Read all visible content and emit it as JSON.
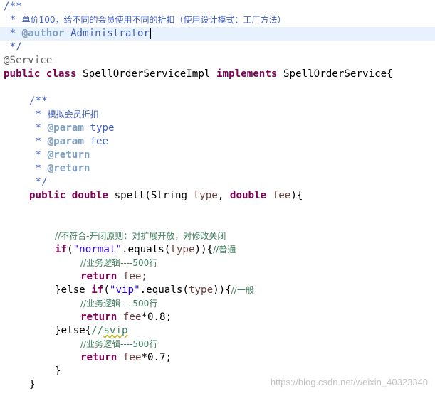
{
  "editor": {
    "javadoc_open": "/**",
    "javadoc_line_1_prefix": " * ",
    "class_doc_text": "单价100，给不同的会员使用不同的折扣（使用设计模式：工厂方法）",
    "author_tag": "@author",
    "author_name": "Administrator",
    "javadoc_close": " */",
    "annotation": "@Service",
    "kw_public": "public",
    "kw_class": "class",
    "class_name": "SpellOrderServiceImpl",
    "kw_implements": "implements",
    "interface_name": "SpellOrderService{",
    "method_doc_open": "/**",
    "method_doc_text": "模拟会员折扣",
    "param_tag": "@param",
    "param_1": "type",
    "param_2": "fee",
    "return_tag": "@return",
    "method_doc_close": "*/",
    "kw_double": "double",
    "method_name": "spell(String",
    "param_type": "type",
    "param_fee": "fee",
    "method_open_tail": "){",
    "comment_ocp": "//不符合-开闭原则：对扩展开放，对修改关闭",
    "kw_if": "if",
    "str_normal": "\"normal\"",
    "equals_call": ".equals(",
    "if_tail": ")){",
    "comment_normal": "//普通",
    "comment_business": "//业务逻辑----500行",
    "kw_return": "return",
    "return_fee": "fee;",
    "else_open": "}else",
    "str_vip": "\"vip\"",
    "comment_general": "//一般",
    "return_vip_tail": "*0.8;",
    "else_only": "}else{",
    "comment_svip_prefix": "//",
    "comment_svip_word": "svip",
    "return_svip_tail": "*0.7;",
    "brace_close": "}"
  },
  "watermark": "https://blog.csdn.net/weixin_40323340"
}
